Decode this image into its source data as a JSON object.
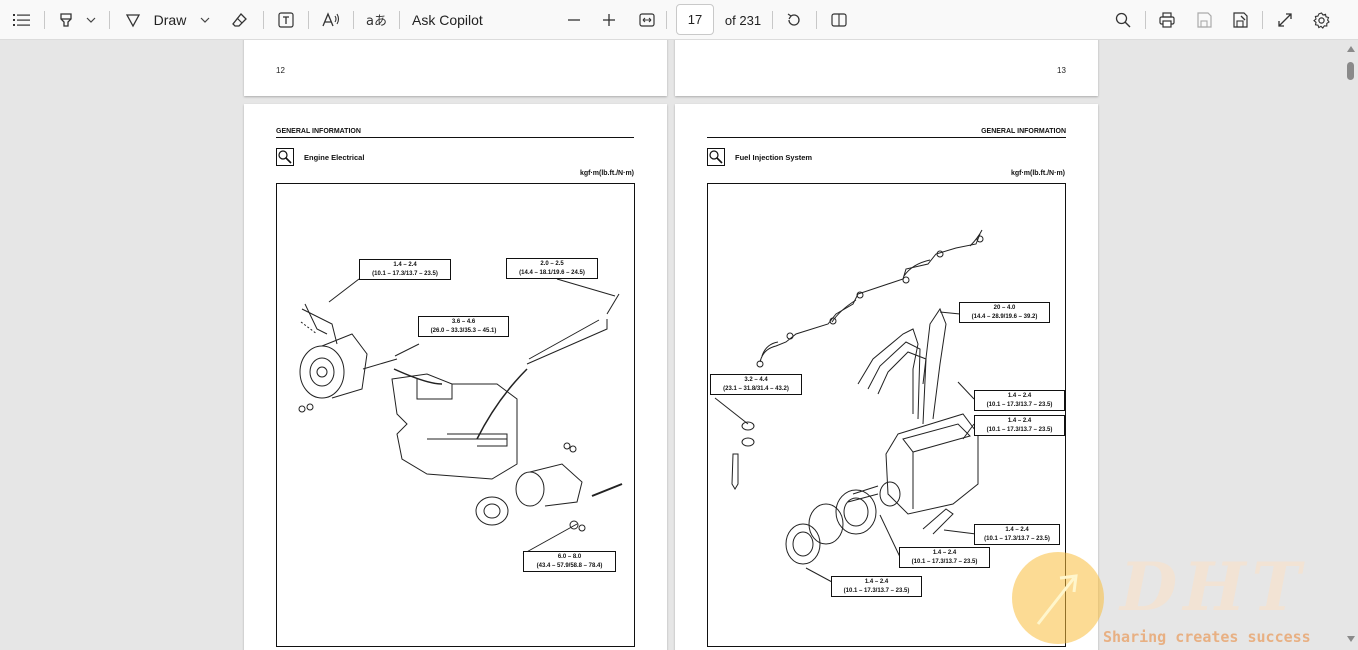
{
  "toolbar": {
    "draw_label": "Draw",
    "copilot_label": "Ask Copilot",
    "page_value": "17",
    "page_total": "of 231"
  },
  "pages_top": [
    {
      "number": "12"
    },
    {
      "number": "13"
    }
  ],
  "left_page": {
    "header": "GENERAL INFORMATION",
    "section": "Engine Electrical",
    "units": "kgf·m(lb.ft./N·m)",
    "callouts": [
      {
        "l1": "1.4 – 2.4",
        "l2": "(10.1 – 17.3/13.7 – 23.5)"
      },
      {
        "l1": "2.0 – 2.5",
        "l2": "(14.4 – 18.1/19.6 – 24.5)"
      },
      {
        "l1": "3.6 – 4.6",
        "l2": "(26.0 – 33.3/35.3 – 45.1)"
      },
      {
        "l1": "6.0 – 8.0",
        "l2": "(43.4 – 57.9/58.8 – 78.4)"
      }
    ]
  },
  "right_page": {
    "header": "GENERAL INFORMATION",
    "section": "Fuel Injection System",
    "units": "kgf·m(lb.ft./N·m)",
    "callouts": [
      {
        "l1": "20 – 4.0",
        "l2": "(14.4 – 28.9/19.6 – 39.2)"
      },
      {
        "l1": "3.2 – 4.4",
        "l2": "(23.1 – 31.8/31.4 – 43.2)"
      },
      {
        "l1": "1.4 – 2.4",
        "l2": "(10.1 – 17.3/13.7 – 23.5)"
      },
      {
        "l1": "1.4 – 2.4",
        "l2": "(10.1 – 17.3/13.7 – 23.5)"
      },
      {
        "l1": "1.4 – 2.4",
        "l2": "(10.1 – 17.3/13.7 – 23.5)"
      },
      {
        "l1": "1.4 – 2.4",
        "l2": "(10.1 – 17.3/13.7 – 23.5)"
      },
      {
        "l1": "1.4 – 2.4",
        "l2": "(10.1 – 17.3/13.7 – 23.5)"
      }
    ]
  },
  "watermark": {
    "brand": "DHT",
    "tagline": "Sharing creates success"
  }
}
